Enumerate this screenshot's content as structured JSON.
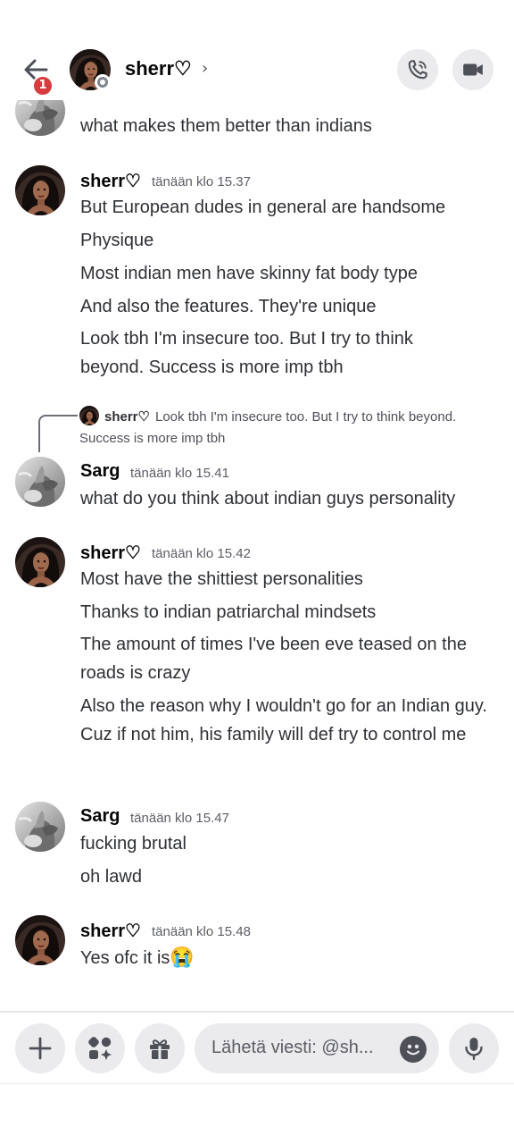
{
  "header": {
    "channel_name": "sherr♡",
    "notification_count": "1"
  },
  "messages": [
    {
      "author": "",
      "time": "",
      "lines": [
        "what makes them better than indians"
      ]
    },
    {
      "author": "sherr♡",
      "time": "tänään klo 15.37",
      "lines": [
        "But European dudes in general are handsome",
        "Physique",
        "Most indian men have skinny fat body type",
        "And also the features. They're unique",
        "Look tbh I'm insecure too. But I try to think beyond. Success is more imp tbh"
      ]
    },
    {
      "author": "Sarg",
      "time": "tänään klo 15.41",
      "lines": [
        "what do you think about indian guys personality"
      ],
      "reply": {
        "author": "sherr♡",
        "text": "Look tbh I'm insecure too. But I try to think beyond. Success is more imp tbh"
      }
    },
    {
      "author": "sherr♡",
      "time": "tänään klo 15.42",
      "lines": [
        "Most have the shittiest personalities",
        "Thanks to indian patriarchal mindsets",
        "The amount of times I've been eve teased on the roads is crazy",
        "Also the reason why I wouldn't go for an Indian guy. Cuz if not him, his family will def try to control me"
      ]
    },
    {
      "author": "Sarg",
      "time": "tänään klo 15.47",
      "lines": [
        "fucking brutal",
        "oh lawd"
      ]
    },
    {
      "author": "sherr♡",
      "time": "tänään klo 15.48",
      "lines": [
        "Yes ofc it is"
      ],
      "emoji": "😭"
    }
  ],
  "composer": {
    "placeholder": "Lähetä viesti: @sh..."
  },
  "icons": {
    "back": "arrow-left-icon",
    "call": "phone-icon",
    "video": "video-camera-icon",
    "add": "plus-icon",
    "apps": "apps-icon",
    "gift": "gift-icon",
    "emoji": "emoji-icon",
    "mic": "microphone-icon"
  },
  "colors": {
    "badge": "#d83c3e",
    "text": "#2e3035",
    "muted": "#5c5e66",
    "button_bg": "#ebebed"
  }
}
